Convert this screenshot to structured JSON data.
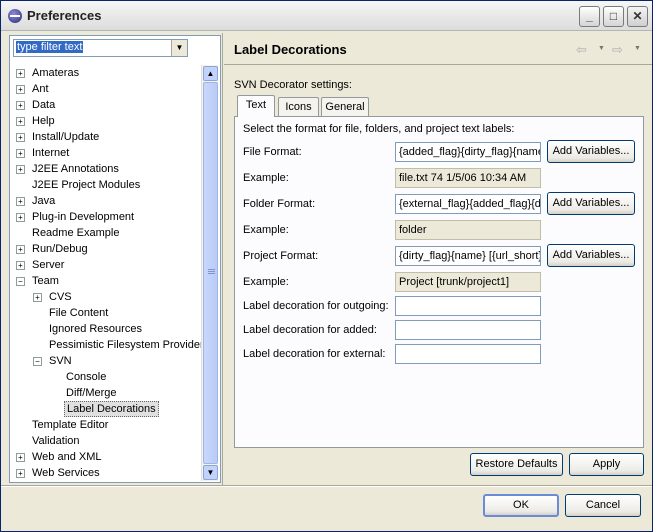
{
  "window": {
    "title": "Preferences"
  },
  "filter": {
    "value": "type filter text"
  },
  "tree": [
    {
      "label": "Amateras",
      "level": 0,
      "expander": "+"
    },
    {
      "label": "Ant",
      "level": 0,
      "expander": "+"
    },
    {
      "label": "Data",
      "level": 0,
      "expander": "+"
    },
    {
      "label": "Help",
      "level": 0,
      "expander": "+"
    },
    {
      "label": "Install/Update",
      "level": 0,
      "expander": "+"
    },
    {
      "label": "Internet",
      "level": 0,
      "expander": "+"
    },
    {
      "label": "J2EE Annotations",
      "level": 0,
      "expander": "+"
    },
    {
      "label": "J2EE Project Modules",
      "level": 0,
      "expander": ""
    },
    {
      "label": "Java",
      "level": 0,
      "expander": "+"
    },
    {
      "label": "Plug-in Development",
      "level": 0,
      "expander": "+"
    },
    {
      "label": "Readme Example",
      "level": 0,
      "expander": ""
    },
    {
      "label": "Run/Debug",
      "level": 0,
      "expander": "+"
    },
    {
      "label": "Server",
      "level": 0,
      "expander": "+"
    },
    {
      "label": "Team",
      "level": 0,
      "expander": "−"
    },
    {
      "label": "CVS",
      "level": 1,
      "expander": "+"
    },
    {
      "label": "File Content",
      "level": 1,
      "expander": ""
    },
    {
      "label": "Ignored Resources",
      "level": 1,
      "expander": ""
    },
    {
      "label": "Pessimistic Filesystem Provider",
      "level": 1,
      "expander": ""
    },
    {
      "label": "SVN",
      "level": 1,
      "expander": "−"
    },
    {
      "label": "Console",
      "level": 2,
      "expander": ""
    },
    {
      "label": "Diff/Merge",
      "level": 2,
      "expander": ""
    },
    {
      "label": "Label Decorations",
      "level": 2,
      "expander": "",
      "selected": true
    },
    {
      "label": "Template Editor",
      "level": 0,
      "expander": ""
    },
    {
      "label": "Validation",
      "level": 0,
      "expander": ""
    },
    {
      "label": "Web and XML",
      "level": 0,
      "expander": "+"
    },
    {
      "label": "Web Services",
      "level": 0,
      "expander": "+"
    }
  ],
  "page": {
    "title": "Label Decorations",
    "section_label": "SVN Decorator settings:",
    "tabs": [
      {
        "label": "Text",
        "active": true
      },
      {
        "label": "Icons",
        "active": false
      },
      {
        "label": "General",
        "active": false
      }
    ],
    "instruction": "Select the format for file, folders, and project text labels:",
    "file_format": {
      "label": "File Format:",
      "value": "{added_flag}{dirty_flag}{name} {revision} {date}",
      "example_label": "Example:",
      "example_value": "file.txt 74  1/5/06 10:34 AM"
    },
    "folder_format": {
      "label": "Folder Format:",
      "value": "{external_flag}{added_flag}{dirty_flag}{name}",
      "example_label": "Example:",
      "example_value": "folder"
    },
    "project_format": {
      "label": "Project Format:",
      "value": "{dirty_flag}{name} [{url_short}]",
      "example_label": "Example:",
      "example_value": "Project [trunk/project1]"
    },
    "add_variables_label": "Add Variables...",
    "outgoing": {
      "label": "Label decoration for outgoing:",
      "value": ""
    },
    "added": {
      "label": "Label decoration for added:",
      "value": ""
    },
    "external": {
      "label": "Label decoration for external:",
      "value": ""
    }
  },
  "buttons": {
    "restore_defaults": "Restore Defaults",
    "apply": "Apply",
    "ok": "OK",
    "cancel": "Cancel"
  },
  "icons": {
    "back": "⇦",
    "forward": "⇨",
    "dropdown": "▼",
    "minimize": "_",
    "maximize": "□",
    "close": "✕",
    "scroll_up": "▲",
    "scroll_down": "▼"
  }
}
